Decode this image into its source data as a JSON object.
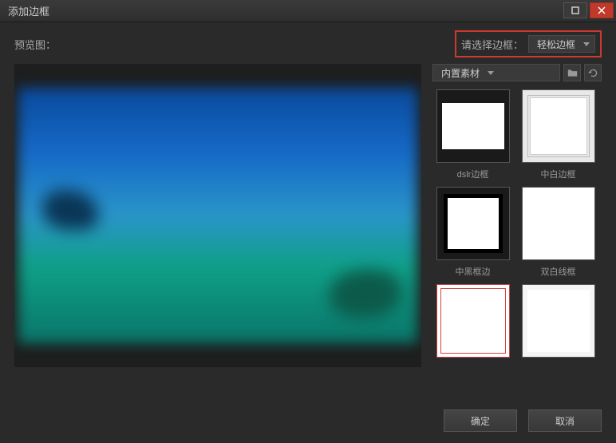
{
  "title": "添加边框",
  "preview_label": "预览图：",
  "frame_select_label": "请选择边框：",
  "frame_select_value": "轻松边框",
  "material_select_value": "内置素材",
  "thumbs": [
    {
      "label": "dslr边框"
    },
    {
      "label": "中白边框"
    },
    {
      "label": "中黑框边"
    },
    {
      "label": "双白线框"
    },
    {
      "label": ""
    },
    {
      "label": ""
    }
  ],
  "buttons": {
    "ok": "确定",
    "cancel": "取消"
  }
}
